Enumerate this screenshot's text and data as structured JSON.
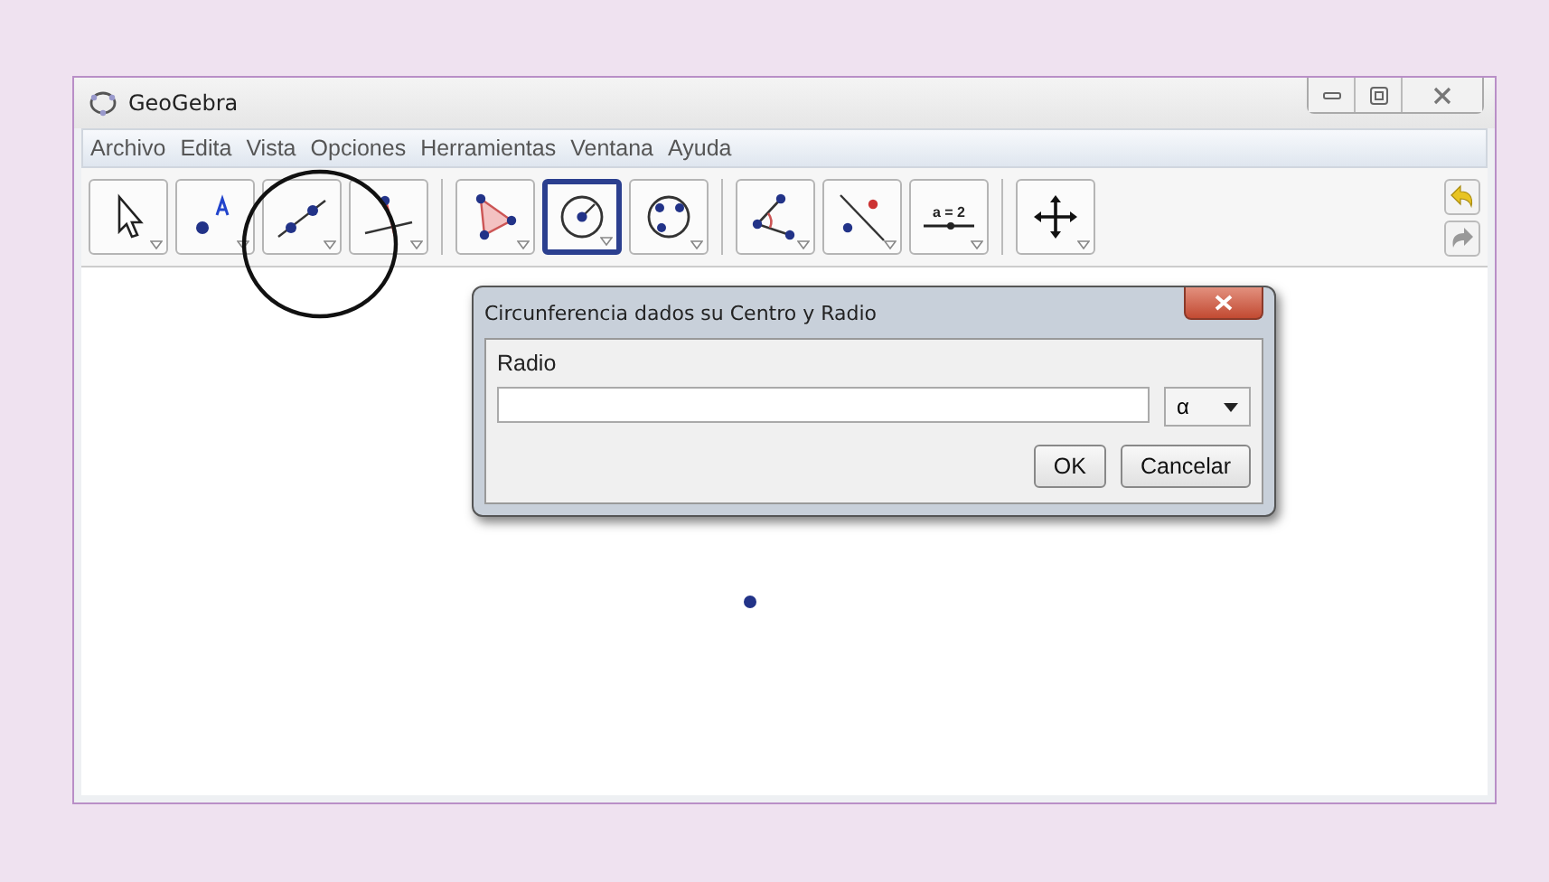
{
  "window": {
    "title": "GeoGebra"
  },
  "menu": [
    "Archivo",
    "Edita",
    "Vista",
    "Opciones",
    "Herramientas",
    "Ventana",
    "Ayuda"
  ],
  "toolbar": [
    {
      "tools": [
        {
          "kind": "move",
          "selected": false
        },
        {
          "kind": "point",
          "selected": false
        },
        {
          "kind": "line",
          "selected": false
        },
        {
          "kind": "perpendicular",
          "selected": false
        }
      ]
    },
    {
      "tools": [
        {
          "kind": "polygon",
          "selected": false
        },
        {
          "kind": "circle",
          "selected": true
        },
        {
          "kind": "conic",
          "selected": false
        }
      ]
    },
    {
      "tools": [
        {
          "kind": "angle",
          "selected": false
        },
        {
          "kind": "reflect",
          "selected": false
        },
        {
          "kind": "slider",
          "selected": false,
          "text": "a = 2"
        }
      ]
    },
    {
      "tools": [
        {
          "kind": "pan",
          "selected": false
        }
      ]
    }
  ],
  "dialog": {
    "title": "Circunferencia dados su Centro y Radio",
    "label": "Radio",
    "symbol": "α",
    "buttons": [
      "OK",
      "Cancelar"
    ]
  }
}
